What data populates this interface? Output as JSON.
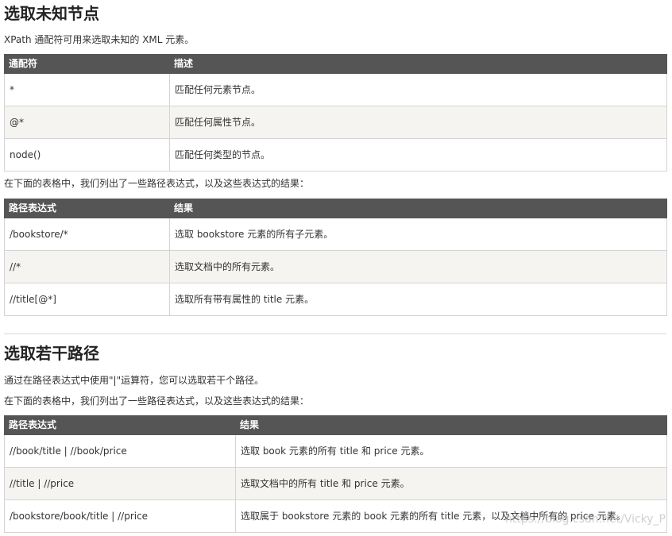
{
  "section1": {
    "title": "选取未知节点",
    "intro": "XPath 通配符可用来选取未知的 XML 元素。",
    "table": {
      "headers": [
        "通配符",
        "描述"
      ],
      "rows": [
        [
          "*",
          "匹配任何元素节点。"
        ],
        [
          "@*",
          "匹配任何属性节点。"
        ],
        [
          "node()",
          "匹配任何类型的节点。"
        ]
      ]
    },
    "intro2": "在下面的表格中，我们列出了一些路径表达式，以及这些表达式的结果：",
    "table2": {
      "headers": [
        "路径表达式",
        "结果"
      ],
      "rows": [
        [
          "/bookstore/*",
          "选取 bookstore 元素的所有子元素。"
        ],
        [
          "//*",
          "选取文档中的所有元素。"
        ],
        [
          "//title[@*]",
          "选取所有带有属性的 title 元素。"
        ]
      ]
    }
  },
  "section2": {
    "title": "选取若干路径",
    "intro": "通过在路径表达式中使用\"|\"运算符，您可以选取若干个路径。",
    "intro2": "在下面的表格中，我们列出了一些路径表达式，以及这些表达式的结果：",
    "table": {
      "headers": [
        "路径表达式",
        "结果"
      ],
      "rows": [
        [
          "//book/title | //book/price",
          "选取 book 元素的所有 title 和 price 元素。"
        ],
        [
          "//title | //price",
          "选取文档中的所有 title 和 price 元素。"
        ],
        [
          "/bookstore/book/title | //price",
          "选取属于 bookstore 元素的 book 元素的所有 title 元素，以及文档中所有的 price 元素。"
        ]
      ]
    }
  },
  "watermark": "https://blog.csdn.net/Vicky_P"
}
